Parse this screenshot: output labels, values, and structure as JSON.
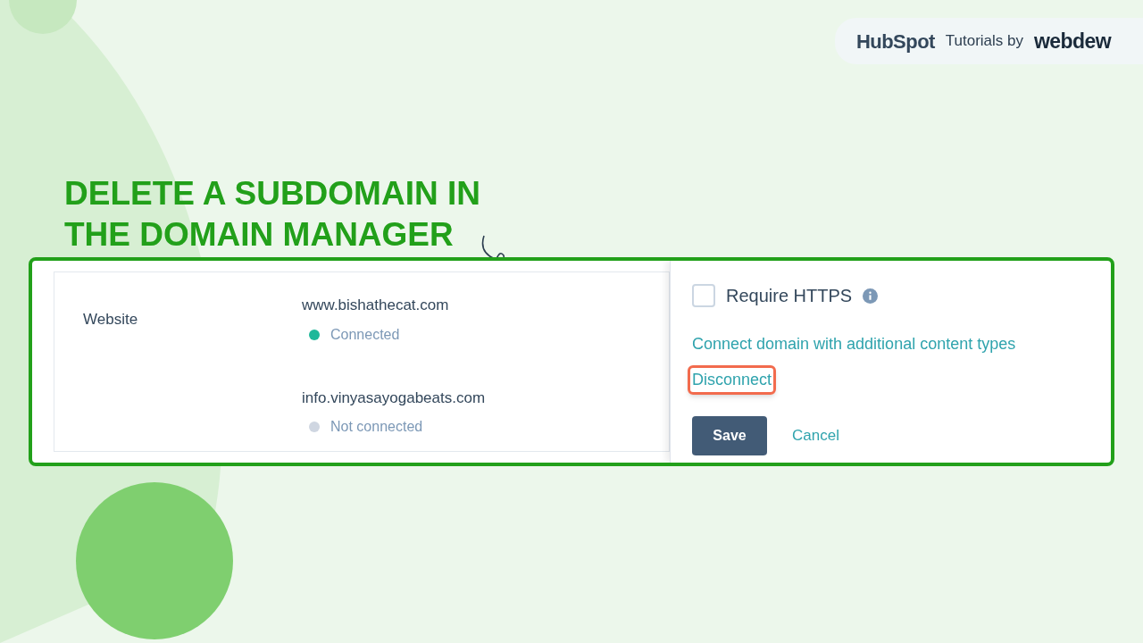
{
  "brand": {
    "logo": "HubSpot",
    "tagline": "Tutorials by",
    "partner": "webdew"
  },
  "title_lines": [
    "DELETE A SUBDOMAIN IN",
    "THE DOMAIN MANAGER"
  ],
  "domains_table": {
    "label": "Website",
    "domains": [
      {
        "name": "www.bishathecat.com",
        "status": "Connected",
        "color": "#1fb89a"
      },
      {
        "name": "info.vinyasayogabeats.com",
        "status": "Not connected",
        "color": "#cfd6e1"
      }
    ]
  },
  "settings": {
    "require_https": {
      "label": "Require HTTPS",
      "checked": false
    },
    "links": [
      {
        "label": "Connect domain with additional content types",
        "highlighted": false
      },
      {
        "label": "Disconnect",
        "highlighted": true
      }
    ],
    "buttons": [
      {
        "label": "Save",
        "kind": "primary"
      },
      {
        "label": "Cancel",
        "kind": "link"
      }
    ]
  }
}
